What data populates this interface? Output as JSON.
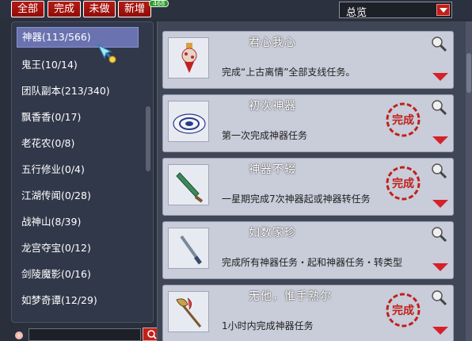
{
  "tabs": [
    {
      "label": "全部"
    },
    {
      "label": "完成"
    },
    {
      "label": "未做"
    },
    {
      "label": "新增"
    }
  ],
  "new_badge": "468",
  "overview": {
    "selected": "总览"
  },
  "sidebar": {
    "items": [
      {
        "label": "神器(113/566)"
      },
      {
        "label": "鬼王(10/14)"
      },
      {
        "label": "团队副本(213/340)"
      },
      {
        "label": "飘香香(0/17)"
      },
      {
        "label": "老花农(0/8)"
      },
      {
        "label": "五行修业(0/4)"
      },
      {
        "label": "江湖传闻(0/28)"
      },
      {
        "label": "战神山(8/39)"
      },
      {
        "label": "龙宫夺宝(0/12)"
      },
      {
        "label": "剑陵魔影(0/16)"
      },
      {
        "label": "如梦奇谭(12/29)"
      }
    ]
  },
  "search": {
    "placeholder": ""
  },
  "achievements": [
    {
      "title": "君心我心",
      "desc": "完成“上古离情”全部支线任务。",
      "completed": false,
      "icon": "pendant-icon"
    },
    {
      "title": "初次神器",
      "desc": "第一次完成神器任务",
      "completed": true,
      "icon": "plate-icon"
    },
    {
      "title": "神器不辍",
      "desc": "一星期完成7次神器起或神器转任务",
      "completed": true,
      "icon": "green-sword-icon"
    },
    {
      "title": "如数家珍",
      "desc": "完成所有神器任务・起和神器任务・转类型",
      "completed": false,
      "icon": "sword-icon"
    },
    {
      "title": "无他，惟手熟尔",
      "desc": "1小时内完成神器任务",
      "completed": true,
      "icon": "axe-icon"
    }
  ],
  "stamp_text": "完成",
  "colors": {
    "accent_red": "#c0201a",
    "selected": "#6a72b0",
    "card": "#c9ccd9"
  }
}
